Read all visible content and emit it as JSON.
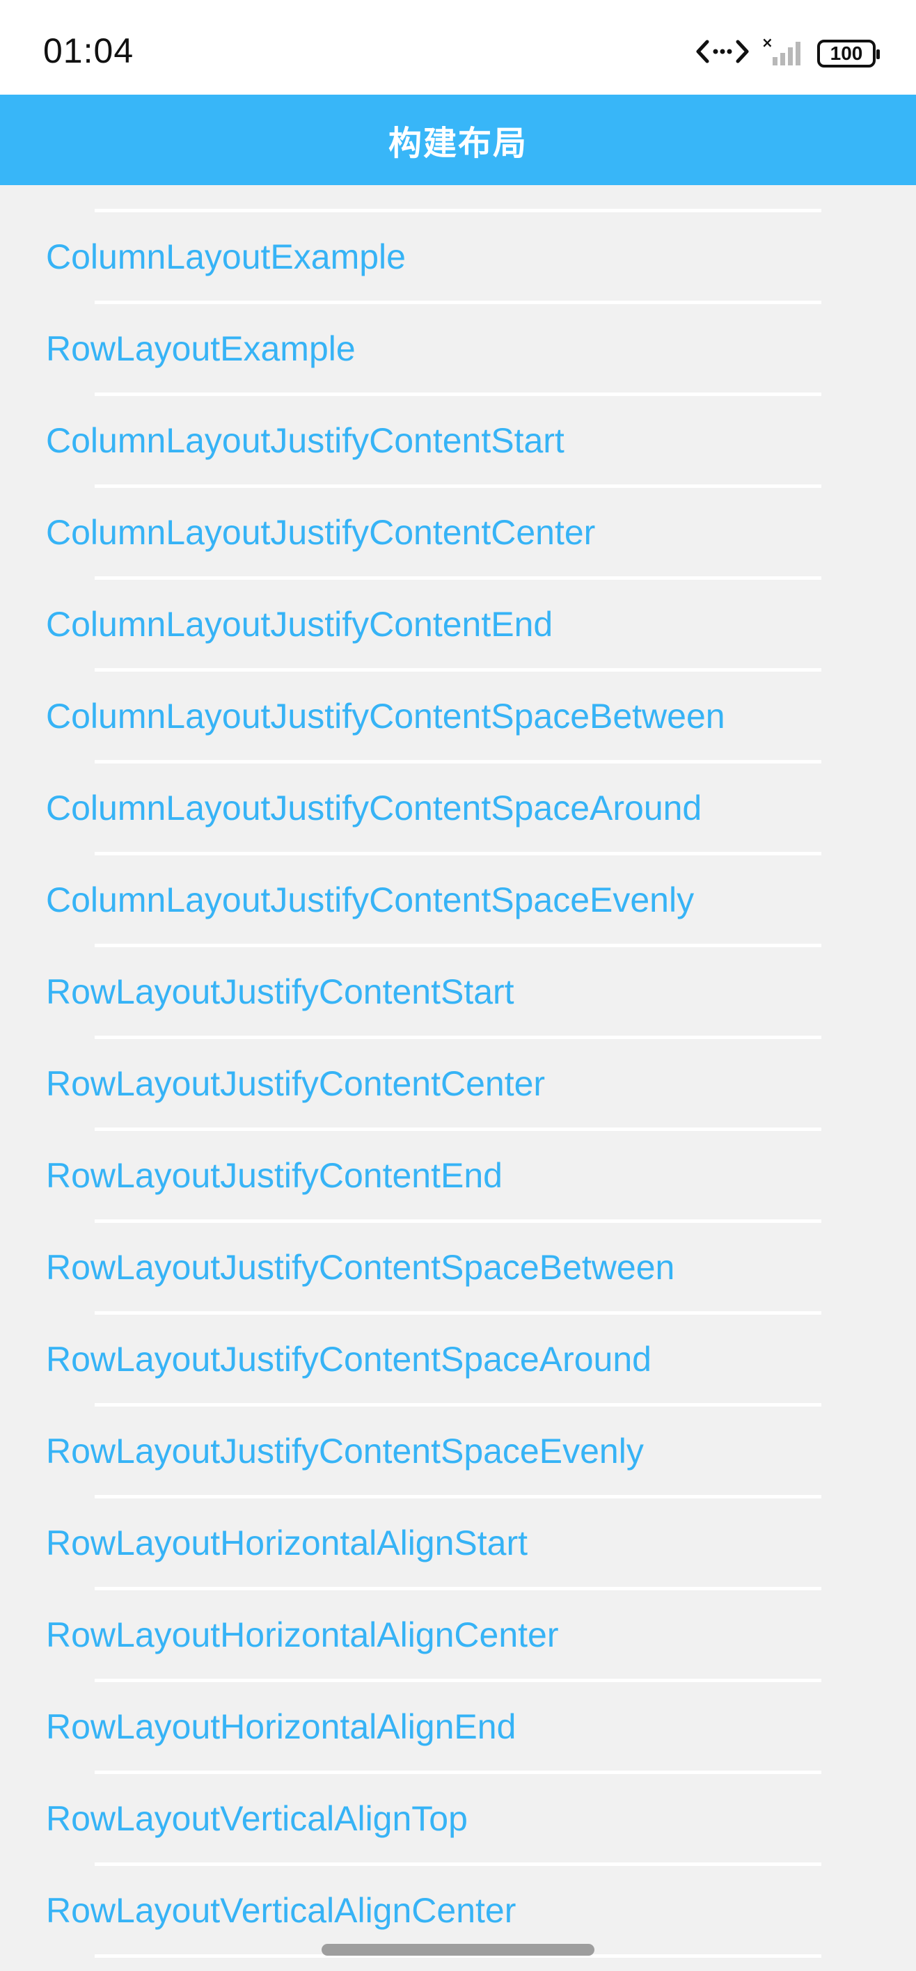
{
  "status_bar": {
    "time": "01:04",
    "battery": "100",
    "icons": [
      "code-arrows-icon",
      "signal-off-icon",
      "battery-icon"
    ]
  },
  "header": {
    "title": "构建布局"
  },
  "colors": {
    "accent": "#38b6f8",
    "link_text": "#36b3f6",
    "background": "#f1f1f1",
    "divider": "#ffffff"
  },
  "list": {
    "items": [
      {
        "label": "ColumnLayoutExample"
      },
      {
        "label": "RowLayoutExample"
      },
      {
        "label": "ColumnLayoutJustifyContentStart"
      },
      {
        "label": "ColumnLayoutJustifyContentCenter"
      },
      {
        "label": "ColumnLayoutJustifyContentEnd"
      },
      {
        "label": "ColumnLayoutJustifyContentSpaceBetween"
      },
      {
        "label": "ColumnLayoutJustifyContentSpaceAround"
      },
      {
        "label": "ColumnLayoutJustifyContentSpaceEvenly"
      },
      {
        "label": "RowLayoutJustifyContentStart"
      },
      {
        "label": "RowLayoutJustifyContentCenter"
      },
      {
        "label": "RowLayoutJustifyContentEnd"
      },
      {
        "label": "RowLayoutJustifyContentSpaceBetween"
      },
      {
        "label": "RowLayoutJustifyContentSpaceAround"
      },
      {
        "label": "RowLayoutJustifyContentSpaceEvenly"
      },
      {
        "label": "RowLayoutHorizontalAlignStart"
      },
      {
        "label": "RowLayoutHorizontalAlignCenter"
      },
      {
        "label": "RowLayoutHorizontalAlignEnd"
      },
      {
        "label": "RowLayoutVerticalAlignTop"
      },
      {
        "label": "RowLayoutVerticalAlignCenter"
      }
    ]
  }
}
